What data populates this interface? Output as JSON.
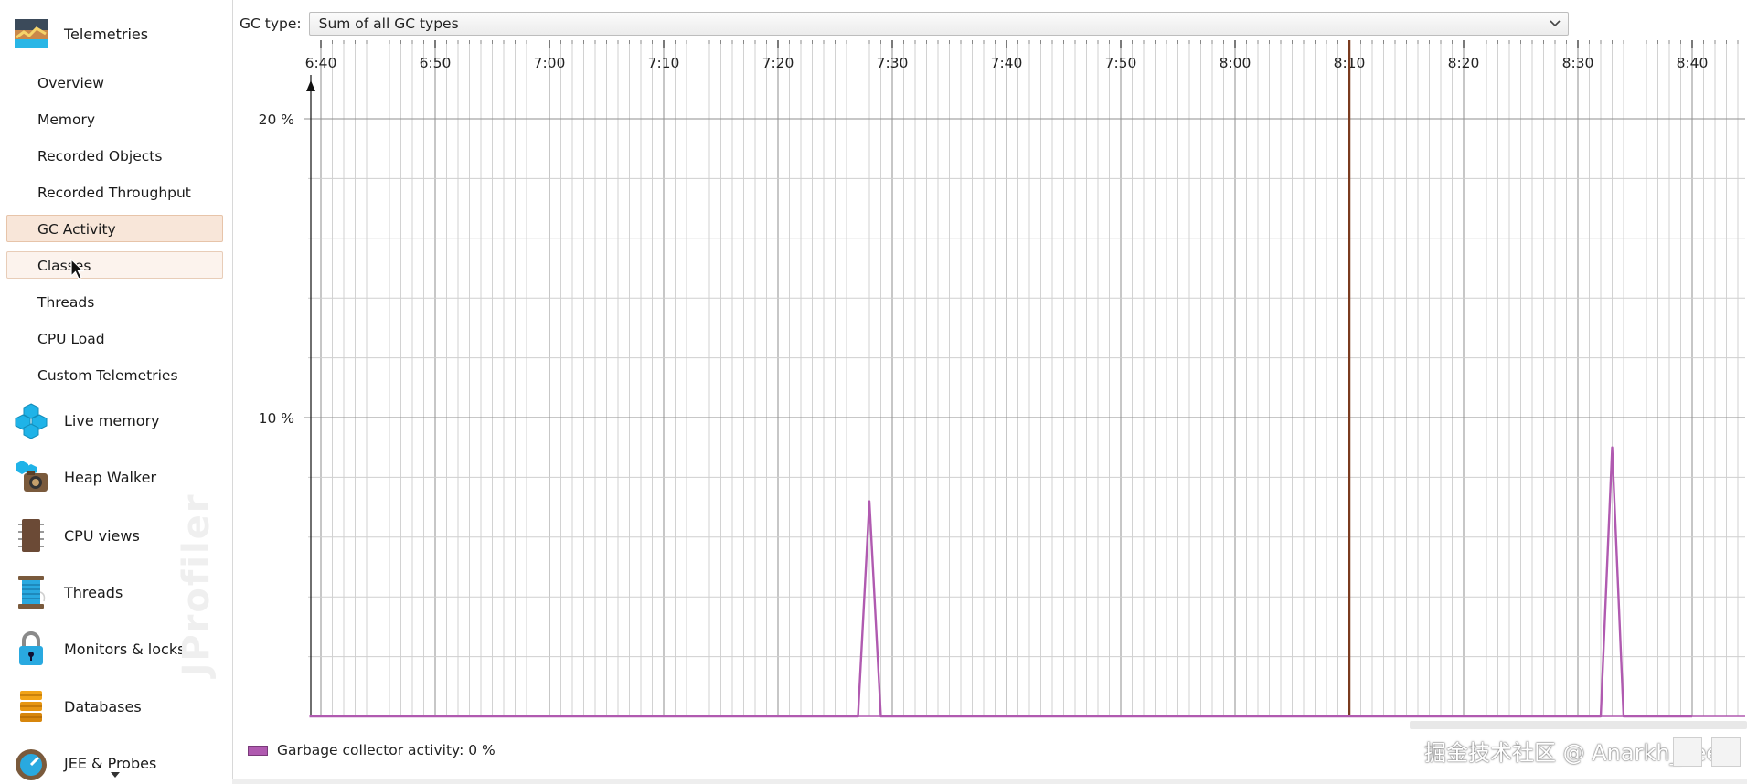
{
  "sidebar": {
    "telemetries_label": "Telemetries",
    "telemetry_items": [
      {
        "label": "Overview"
      },
      {
        "label": "Memory"
      },
      {
        "label": "Recorded Objects"
      },
      {
        "label": "Recorded Throughput"
      },
      {
        "label": "GC Activity",
        "selected": true
      },
      {
        "label": "Classes",
        "hovered": true
      },
      {
        "label": "Threads"
      },
      {
        "label": "CPU Load"
      },
      {
        "label": "Custom Telemetries"
      }
    ],
    "sections": [
      {
        "label": "Live memory",
        "icon": "live-memory-icon"
      },
      {
        "label": "Heap Walker",
        "icon": "heap-walker-icon"
      },
      {
        "label": "CPU views",
        "icon": "cpu-views-icon"
      },
      {
        "label": "Threads",
        "icon": "threads-icon"
      },
      {
        "label": "Monitors & locks",
        "icon": "monitors-locks-icon"
      },
      {
        "label": "Databases",
        "icon": "databases-icon"
      },
      {
        "label": "JEE & Probes",
        "icon": "jee-probes-icon"
      }
    ],
    "watermark": "JProfiler"
  },
  "toolbar": {
    "gc_type_label": "GC type:",
    "gc_type_value": "Sum of all GC types"
  },
  "chart_data": {
    "type": "line",
    "x_tick_labels": [
      "6:40",
      "6:50",
      "7:00",
      "7:10",
      "7:20",
      "7:30",
      "7:40",
      "7:50",
      "8:00",
      "8:10",
      "8:20",
      "8:30",
      "8:40"
    ],
    "y_tick_labels": [
      "20 %",
      "10 %"
    ],
    "ylim": [
      0,
      20
    ],
    "grid": true,
    "series": [
      {
        "name": "Garbage collector activity",
        "color": "#b05ab0",
        "points": [
          {
            "t": "6:39",
            "v": 0
          },
          {
            "t": "7:27",
            "v": 0
          },
          {
            "t": "7:28",
            "v": 7.2
          },
          {
            "t": "7:29",
            "v": 0
          },
          {
            "t": "8:32",
            "v": 0
          },
          {
            "t": "8:33",
            "v": 9.0
          },
          {
            "t": "8:34",
            "v": 0
          },
          {
            "t": "8:40",
            "v": 0
          }
        ]
      }
    ],
    "marker_time": "8:10",
    "marker_color": "#7a3b1f"
  },
  "legend": {
    "label": "Garbage collector activity: 0 %",
    "color": "#b05ab0"
  },
  "overlay_watermark": "掘金技术社区 @ Anarkh_Lee"
}
